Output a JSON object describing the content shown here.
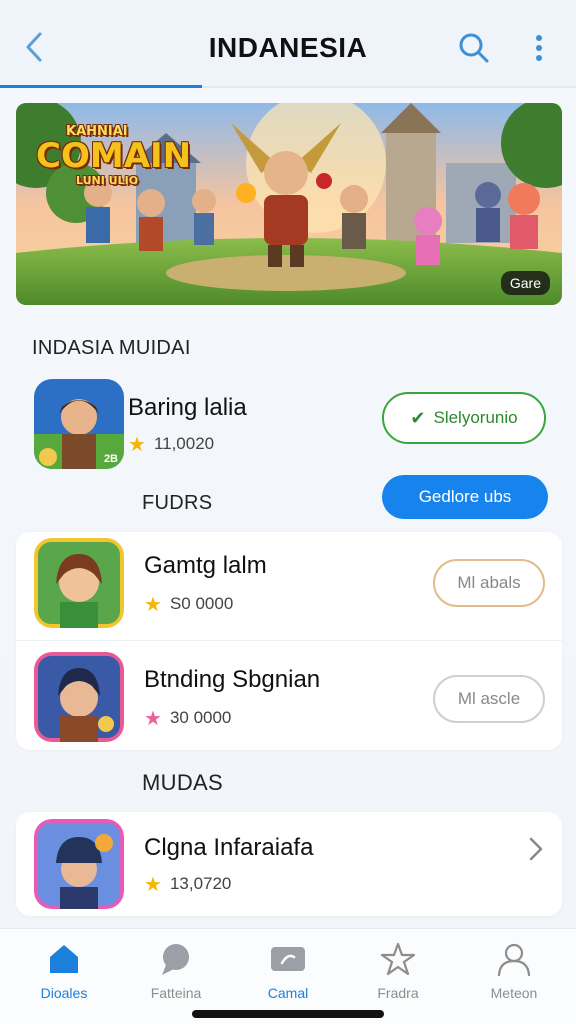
{
  "header": {
    "title": "INDANESIA"
  },
  "banner": {
    "logo_top": "KAHNIAI",
    "logo_main": "COMAIN",
    "logo_sub": "LUNI ULIO",
    "chip": "Gare"
  },
  "section1": {
    "title": "INDASIA MUIDAI",
    "app": {
      "name": "Baring lalia",
      "rating": "11,0020",
      "install_label": "Slelyorunio",
      "badge": "2B"
    },
    "subtitle": "FUDRS",
    "action_label": "Gedlore ubs"
  },
  "list": [
    {
      "name": "Gamtg lalm",
      "rating": "S0 0000",
      "button": "Ml abals"
    },
    {
      "name": "Btnding Sbgnian",
      "rating": "30 0000",
      "button": "Ml ascle"
    }
  ],
  "section2": {
    "title": "MUDAS",
    "app": {
      "name": "Clgna Infaraiafa",
      "rating": "13,0720"
    }
  },
  "bottom_nav": [
    {
      "label": "Dioales",
      "icon": "home-icon"
    },
    {
      "label": "Fatteina",
      "icon": "chat-icon"
    },
    {
      "label": "Camal",
      "icon": "card-icon"
    },
    {
      "label": "Fradra",
      "icon": "star-icon"
    },
    {
      "label": "Meteon",
      "icon": "profile-icon"
    }
  ],
  "colors": {
    "accent": "#1784ee",
    "green": "#39a53a",
    "star": "#f2b705"
  }
}
